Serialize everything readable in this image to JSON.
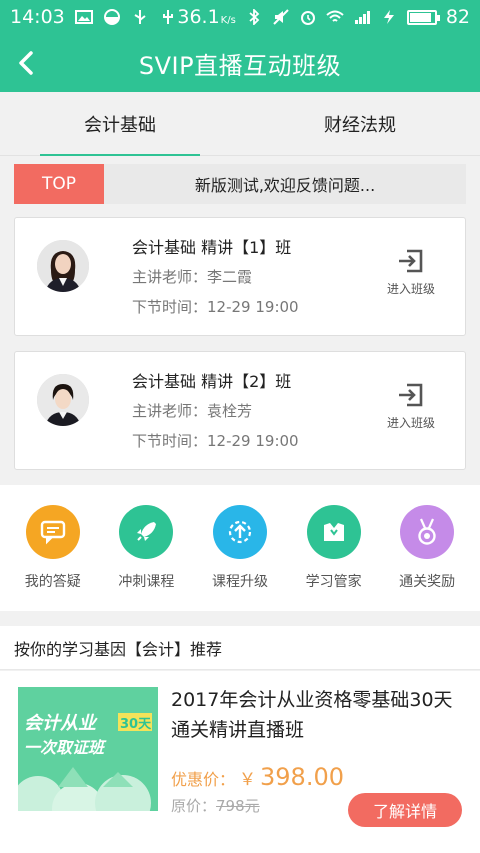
{
  "status_bar": {
    "time": "14:03",
    "network_speed": "36.1",
    "speed_unit": "K/s",
    "battery": "82",
    "battery_level": 0.82
  },
  "header": {
    "title": "SVIP直播互动班级"
  },
  "tabs": [
    {
      "label": "会计基础",
      "active": true
    },
    {
      "label": "财经法规",
      "active": false
    }
  ],
  "notice": {
    "tag": "TOP",
    "text": "新版测试,欢迎反馈问题..."
  },
  "classes": [
    {
      "name": "会计基础 精讲【1】班",
      "teacher": "主讲老师：李二霞",
      "next_time": "下节时间：12-29 19:00",
      "enter_label": "进入班级"
    },
    {
      "name": "会计基础 精讲【2】班",
      "teacher": "主讲老师：袁栓芳",
      "next_time": "下节时间：12-29 19:00",
      "enter_label": "进入班级"
    }
  ],
  "features": [
    {
      "label": "我的答疑",
      "color": "#f5a623",
      "icon": "chat-icon"
    },
    {
      "label": "冲刺课程",
      "color": "#2ec394",
      "icon": "rocket-icon"
    },
    {
      "label": "课程升级",
      "color": "#29b6e8",
      "icon": "upgrade-icon"
    },
    {
      "label": "学习管家",
      "color": "#2ec394",
      "icon": "butler-icon"
    },
    {
      "label": "通关奖励",
      "color": "#c58be8",
      "icon": "medal-icon"
    }
  ],
  "recommend": {
    "header": "按你的学习基因【会计】推荐",
    "course": {
      "title": "2017年会计从业资格零基础30天通关精讲直播班",
      "image_text_1": "会计从业",
      "image_text_2": "30天",
      "image_text_3": "一次取证班",
      "price_label": "优惠价：",
      "currency": "￥",
      "price": "398.00",
      "original_price_label": "原价：",
      "original_price": "798元",
      "detail_button": "了解详情"
    }
  },
  "colors": {
    "brand": "#2ec394",
    "accent_red": "#f26b61",
    "price_orange": "#f1a04b"
  }
}
